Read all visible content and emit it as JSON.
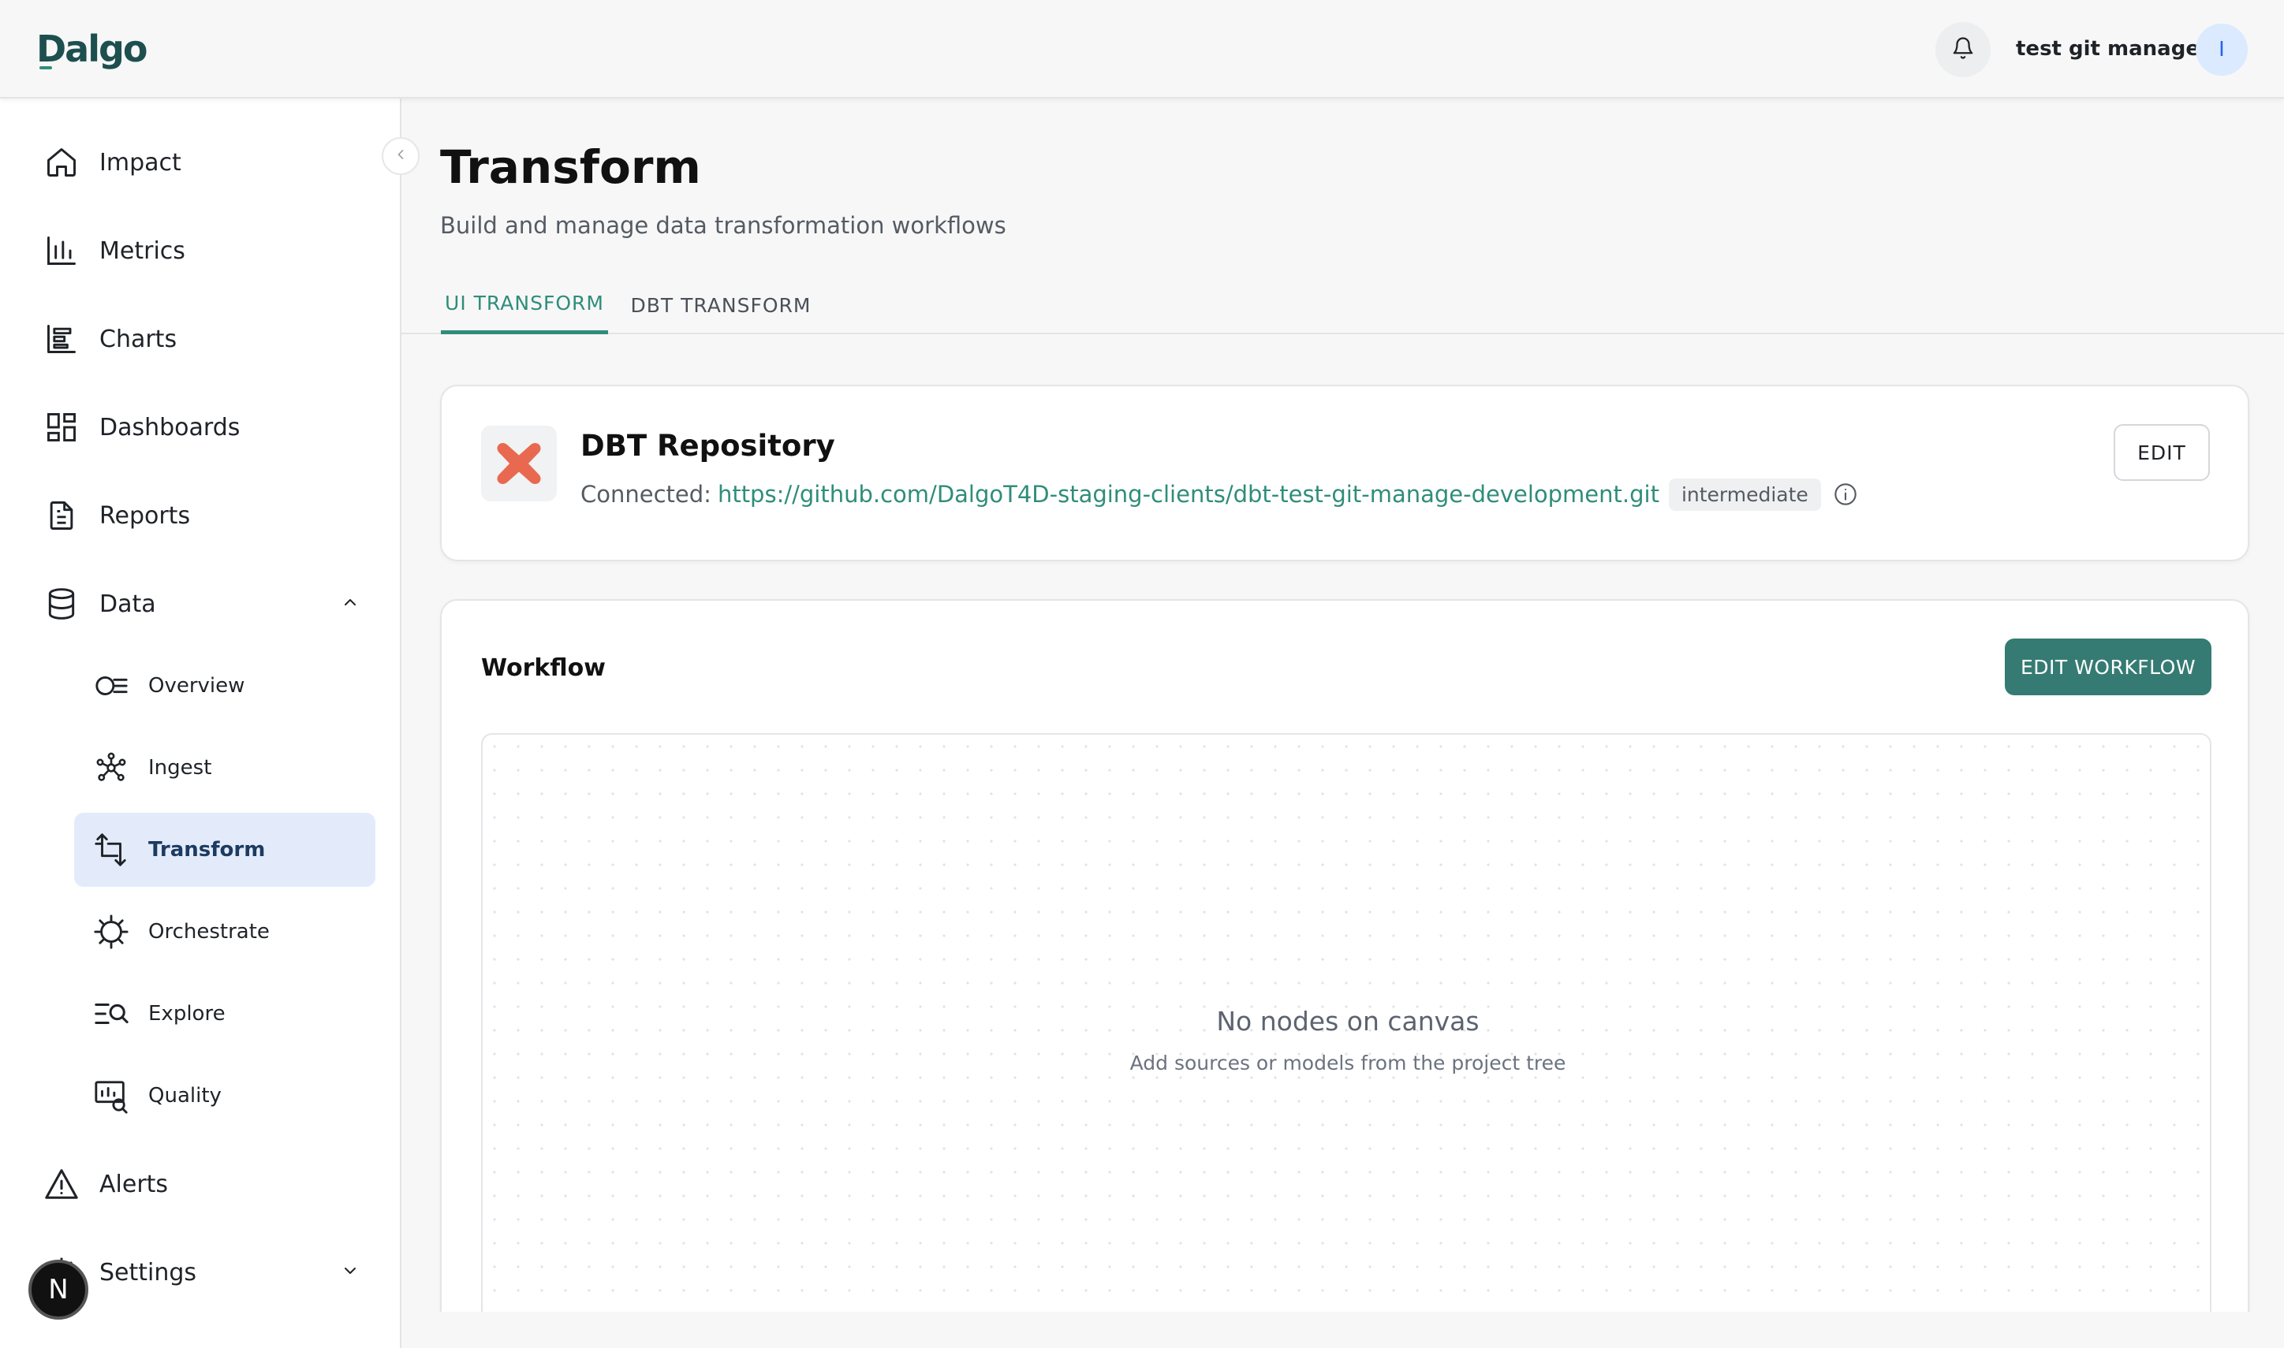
{
  "header": {
    "logo": "Dalgo",
    "user_name": "test git manage",
    "avatar_initial": "I"
  },
  "sidebar": {
    "items": [
      {
        "label": "Impact",
        "icon": "home-icon"
      },
      {
        "label": "Metrics",
        "icon": "bar-chart-icon"
      },
      {
        "label": "Charts",
        "icon": "charts-icon"
      },
      {
        "label": "Dashboards",
        "icon": "dashboard-grid-icon"
      },
      {
        "label": "Reports",
        "icon": "document-icon"
      },
      {
        "label": "Data",
        "icon": "database-icon",
        "expanded": true
      },
      {
        "label": "Alerts",
        "icon": "warning-icon"
      },
      {
        "label": "Settings",
        "icon": "gear-icon",
        "expanded": false
      }
    ],
    "data_children": [
      {
        "label": "Overview",
        "icon": "overview-icon"
      },
      {
        "label": "Ingest",
        "icon": "ingest-icon"
      },
      {
        "label": "Transform",
        "icon": "transform-icon",
        "active": true
      },
      {
        "label": "Orchestrate",
        "icon": "orchestrate-icon"
      },
      {
        "label": "Explore",
        "icon": "explore-icon"
      },
      {
        "label": "Quality",
        "icon": "quality-icon"
      }
    ],
    "floating_badge": "N"
  },
  "page": {
    "title": "Transform",
    "subtitle": "Build and manage data transformation workflows"
  },
  "tabs": [
    {
      "label": "UI TRANSFORM",
      "active": true
    },
    {
      "label": "DBT TRANSFORM",
      "active": false
    }
  ],
  "repo": {
    "title": "DBT Repository",
    "prefix": "Connected:",
    "url": "https://github.com/DalgoT4D-staging-clients/dbt-test-git-manage-development.git",
    "badge": "intermediate",
    "edit_label": "EDIT"
  },
  "workflow": {
    "title": "Workflow",
    "edit_label": "EDIT WORKFLOW",
    "empty_title": "No nodes on canvas",
    "empty_subtitle": "Add sources or models from the project tree"
  },
  "colors": {
    "accent": "#2f8d7a",
    "button_primary": "#357b73",
    "active_nav_bg": "#e3ebfb",
    "dbt_logo": "#e8694f"
  }
}
